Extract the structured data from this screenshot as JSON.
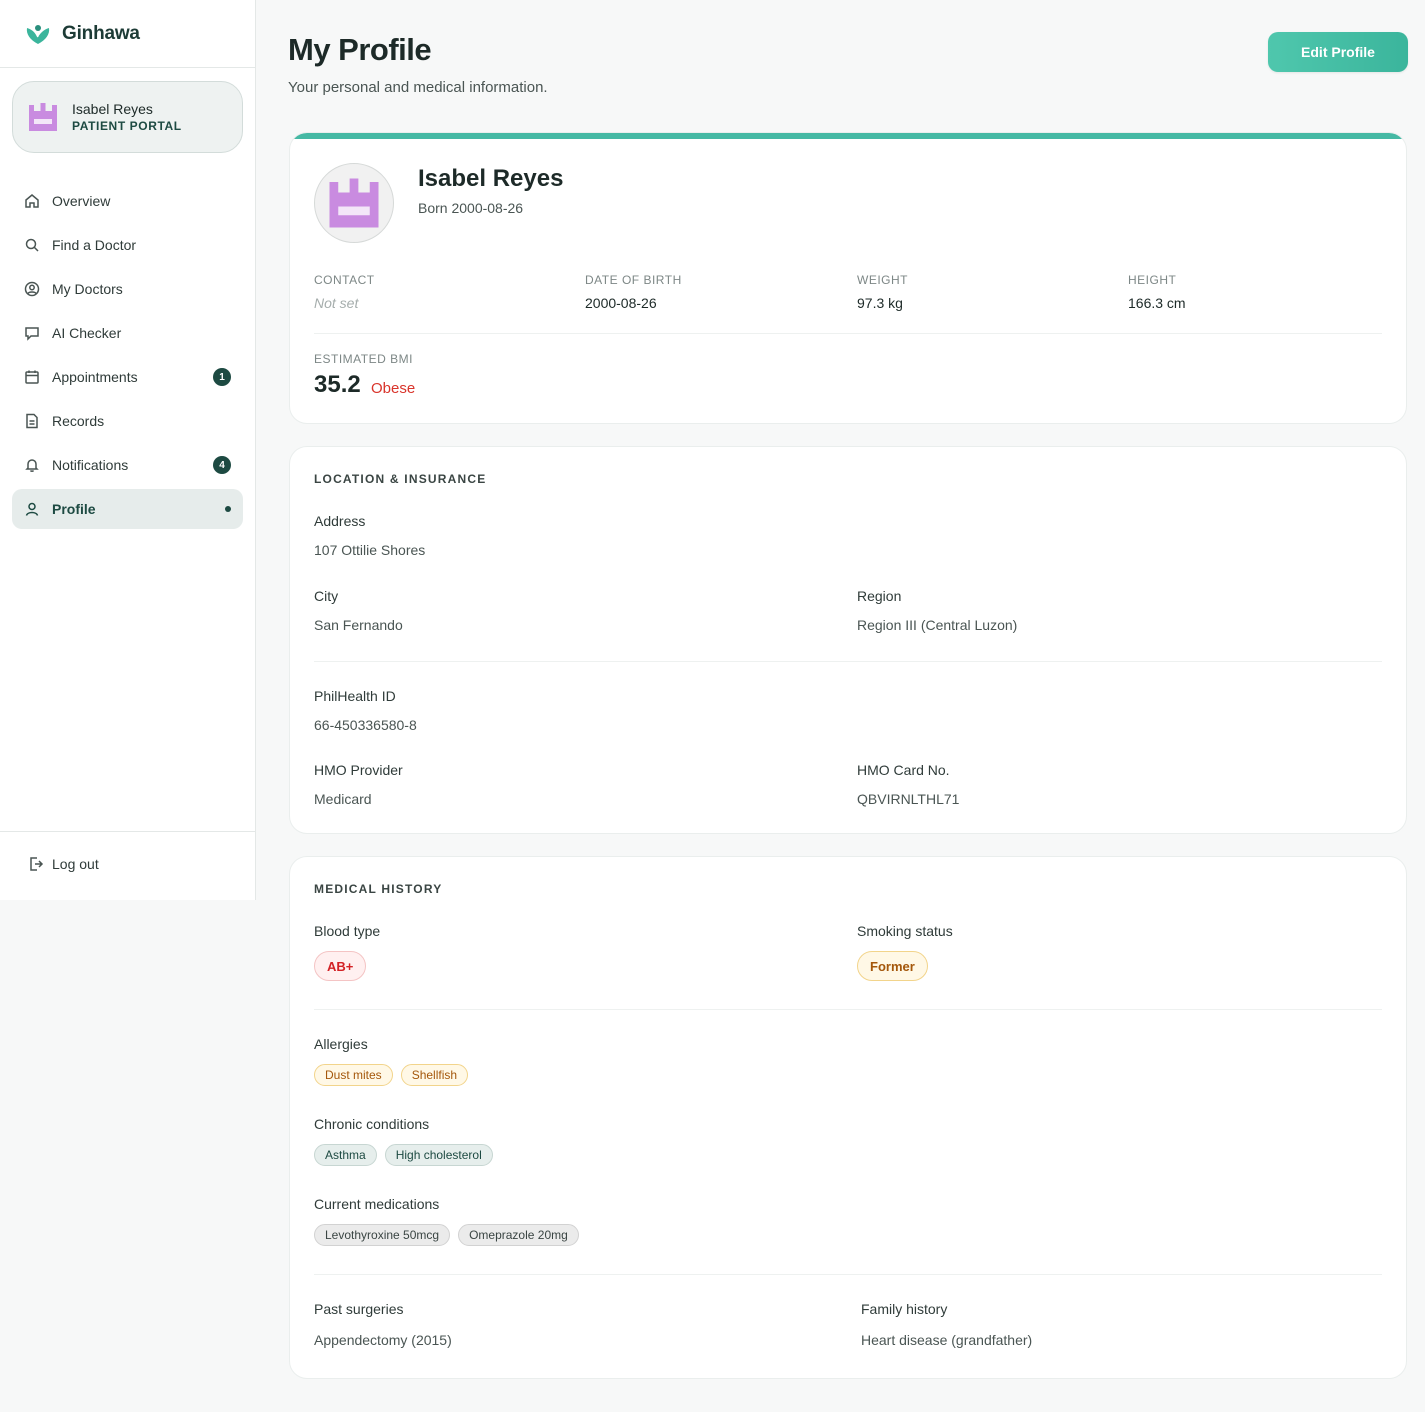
{
  "brand": {
    "name": "Ginhawa"
  },
  "user": {
    "name": "Isabel Reyes",
    "role": "PATIENT PORTAL"
  },
  "nav": {
    "items": [
      {
        "label": "Overview",
        "icon": "home-icon"
      },
      {
        "label": "Find a Doctor",
        "icon": "search-icon"
      },
      {
        "label": "My Doctors",
        "icon": "user-circle-icon"
      },
      {
        "label": "AI Checker",
        "icon": "chat-icon"
      },
      {
        "label": "Appointments",
        "icon": "calendar-icon",
        "badge": "1"
      },
      {
        "label": "Records",
        "icon": "document-icon"
      },
      {
        "label": "Notifications",
        "icon": "bell-icon",
        "badge": "4"
      },
      {
        "label": "Profile",
        "icon": "user-icon",
        "active": true
      }
    ],
    "logout": "Log out"
  },
  "header": {
    "title": "My Profile",
    "subtitle": "Your personal and medical information.",
    "edit_label": "Edit Profile"
  },
  "profile": {
    "name": "Isabel Reyes",
    "born": "Born 2000-08-26",
    "contact_label": "CONTACT",
    "contact_value": "Not set",
    "dob_label": "DATE OF BIRTH",
    "dob_value": "2000-08-26",
    "weight_label": "WEIGHT",
    "weight_value": "97.3 kg",
    "height_label": "HEIGHT",
    "height_value": "166.3 cm",
    "bmi_label": "ESTIMATED BMI",
    "bmi_value": "35.2",
    "bmi_category": "Obese"
  },
  "location": {
    "title": "LOCATION & INSURANCE",
    "address_label": "Address",
    "address_value": "107 Ottilie Shores",
    "city_label": "City",
    "city_value": "San Fernando",
    "region_label": "Region",
    "region_value": "Region III (Central Luzon)",
    "philhealth_label": "PhilHealth ID",
    "philhealth_value": "66-450336580-8",
    "hmo_label": "HMO Provider",
    "hmo_value": "Medicard",
    "hmo_card_label": "HMO Card No.",
    "hmo_card_value": "QBVIRNLTHL71"
  },
  "medical": {
    "title": "MEDICAL HISTORY",
    "blood_label": "Blood type",
    "blood_value": "AB+",
    "smoking_label": "Smoking status",
    "smoking_value": "Former",
    "allergies_label": "Allergies",
    "allergies": [
      "Dust mites",
      "Shellfish"
    ],
    "chronic_label": "Chronic conditions",
    "chronic": [
      "Asthma",
      "High cholesterol"
    ],
    "meds_label": "Current medications",
    "meds": [
      "Levothyroxine 50mcg",
      "Omeprazole 20mg"
    ],
    "surgeries_label": "Past surgeries",
    "surgeries_value": "Appendectomy (2015)",
    "family_label": "Family history",
    "family_value": "Heart disease (grandfather)"
  },
  "colors": {
    "accent": "#45b9a4",
    "primary_dark": "#1d4a42",
    "danger": "#d9342b",
    "avatar_purple": "#c98be0"
  }
}
